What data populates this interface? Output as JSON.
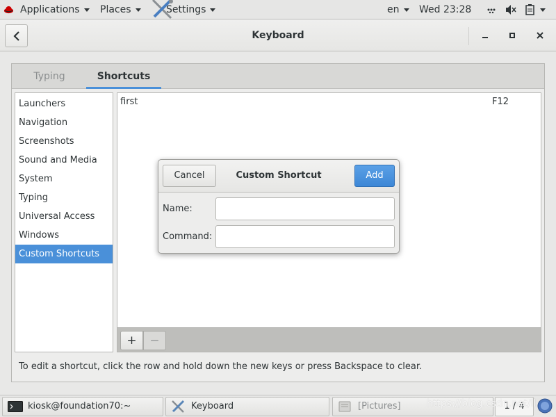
{
  "top_panel": {
    "applications": "Applications",
    "places": "Places",
    "settings": "Settings",
    "language": "en",
    "clock": "Wed 23:28"
  },
  "window": {
    "title": "Keyboard"
  },
  "tabs": [
    {
      "label": "Typing",
      "active": false
    },
    {
      "label": "Shortcuts",
      "active": true
    }
  ],
  "categories": [
    {
      "label": "Launchers"
    },
    {
      "label": "Navigation"
    },
    {
      "label": "Screenshots"
    },
    {
      "label": "Sound and Media"
    },
    {
      "label": "System"
    },
    {
      "label": "Typing"
    },
    {
      "label": "Universal Access"
    },
    {
      "label": "Windows"
    },
    {
      "label": "Custom Shortcuts",
      "selected": true
    }
  ],
  "shortcuts": [
    {
      "name": "first",
      "accel": "F12"
    }
  ],
  "list_toolbar": {
    "add_label": "+",
    "remove_label": "−"
  },
  "hint": "To edit a shortcut, click the row and hold down the new keys or press Backspace to clear.",
  "dialog": {
    "title": "Custom Shortcut",
    "cancel_label": "Cancel",
    "add_label": "Add",
    "name_label": "Name:",
    "name_value": "",
    "command_label": "Command:",
    "command_value": ""
  },
  "taskbar": {
    "tasks": [
      {
        "label": "kiosk@foundation70:~",
        "icon": "terminal-icon"
      },
      {
        "label": "Keyboard",
        "icon": "settings-tools-icon"
      },
      {
        "label": "[Pictures]",
        "icon": "file-manager-icon"
      }
    ],
    "workspace": "1 / 4",
    "watermark": "https://blog.csdn.net/ll"
  },
  "colors": {
    "accent": "#4a90d9",
    "add_button": "#3d87d6"
  }
}
